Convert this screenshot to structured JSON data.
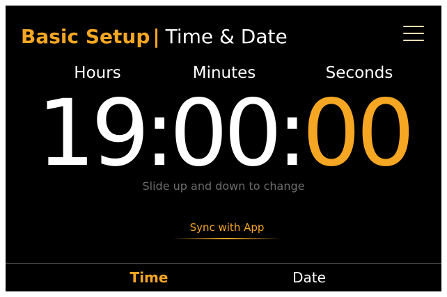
{
  "header": {
    "section_title": "Basic Setup",
    "separator": "|",
    "page_title": "Time & Date",
    "menu_icon": "hamburger-menu-icon"
  },
  "time": {
    "labels": {
      "hours": "Hours",
      "minutes": "Minutes",
      "seconds": "Seconds"
    },
    "hours": "19",
    "minutes": "00",
    "seconds": "00",
    "separator": ":",
    "active_unit": "seconds"
  },
  "hint": "Slide up and down to change",
  "sync_button": "Sync with App",
  "tabs": [
    {
      "label": "Time",
      "active": true
    },
    {
      "label": "Date",
      "active": false
    }
  ],
  "colors": {
    "accent": "#f5a623",
    "background": "#000000",
    "text": "#ffffff",
    "hint": "#6e6e6e"
  }
}
